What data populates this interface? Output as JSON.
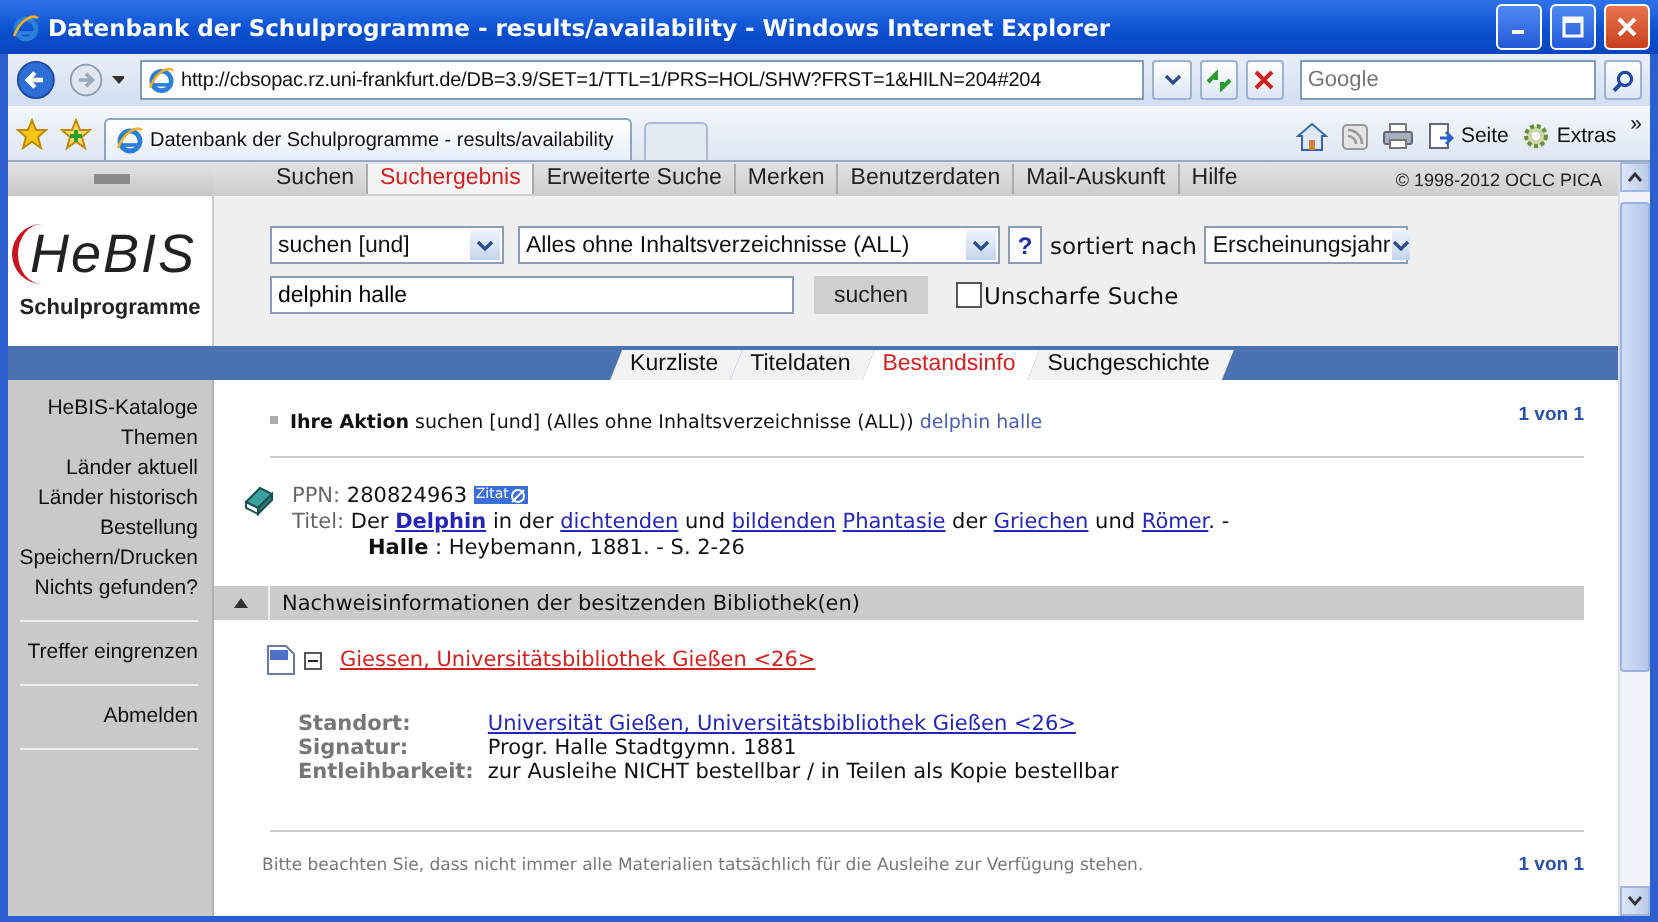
{
  "window": {
    "title": "Datenbank der Schulprogramme - results/availability - Windows Internet Explorer"
  },
  "browser": {
    "address": "http://cbsopac.rz.uni-frankfurt.de/DB=3.9/SET=1/TTL=1/PRS=HOL/SHW?FRST=1&HILN=204#204",
    "search_placeholder": "Google",
    "tab": "Datenbank der Schulprogramme - results/availability",
    "tools": [
      "Seite",
      "Extras"
    ],
    "overflow": "»"
  },
  "nav": {
    "items": [
      {
        "label": "Suchen",
        "selected": false
      },
      {
        "label": "Suchergebnis",
        "selected": true
      },
      {
        "label": "Erweiterte Suche",
        "selected": false
      },
      {
        "label": "Merken",
        "selected": false
      },
      {
        "label": "Benutzerdaten",
        "selected": false
      },
      {
        "label": "Mail-Auskunft",
        "selected": false
      },
      {
        "label": "Hilfe",
        "selected": false
      }
    ],
    "copyright": "© 1998-2012 OCLC PICA"
  },
  "logo": {
    "name": "HeBIS",
    "subtitle": "Schulprogramme"
  },
  "search": {
    "operator": "suchen [und]",
    "index": "Alles ohne Inhaltsverzeichnisse (ALL)",
    "help": "?",
    "sort_label": "sortiert nach",
    "sort": "Erscheinungsjahr",
    "query": "delphin halle",
    "button": "suchen",
    "fuzzy": {
      "label": "Unscharfe Suche",
      "checked": false
    }
  },
  "view_tabs": [
    {
      "label": "Kurzliste",
      "selected": false
    },
    {
      "label": "Titeldaten",
      "selected": false
    },
    {
      "label": "Bestandsinfo",
      "selected": true
    },
    {
      "label": "Suchgeschichte",
      "selected": false
    }
  ],
  "sidebar": {
    "groups": [
      [
        {
          "label": "HeBIS-Kataloge"
        },
        {
          "label": "Themen"
        },
        {
          "label": "Länder aktuell"
        },
        {
          "label": "Länder historisch"
        },
        {
          "label": "Bestellung"
        },
        {
          "label": "Speichern/Drucken"
        },
        {
          "label": "Nichts gefunden?"
        }
      ],
      [
        {
          "label": "Treffer eingrenzen"
        }
      ],
      [
        {
          "label": "Abmelden"
        }
      ]
    ]
  },
  "action": {
    "label": "Ihre Aktion",
    "text": "suchen [und] (Alles ohne Inhaltsverzeichnisse (ALL))",
    "query": "delphin halle",
    "pager": "1 von 1"
  },
  "record": {
    "ppn_label": "PPN:",
    "ppn": "280824963",
    "cite": "Zitat",
    "title_label": "Titel:",
    "title": [
      {
        "kind": "text",
        "text": "Der "
      },
      {
        "kind": "strong-link",
        "text": "Delphin"
      },
      {
        "kind": "text",
        "text": " in der "
      },
      {
        "kind": "link",
        "text": "dichtenden"
      },
      {
        "kind": "text",
        "text": " und "
      },
      {
        "kind": "link",
        "text": "bildenden"
      },
      {
        "kind": "link",
        "text": "Phantasie"
      },
      {
        "kind": "text",
        "text": " der "
      },
      {
        "kind": "link",
        "text": "Griechen"
      },
      {
        "kind": "text",
        "text": " und "
      },
      {
        "kind": "link",
        "text": "Römer"
      },
      {
        "kind": "text",
        "text": ". -"
      }
    ],
    "imprint": "**Halle** : Heybemann, 1881. - S. 2-26"
  },
  "holdings": {
    "heading": "Nachweisinformationen der besitzenden Bibliothek(en)",
    "expanded": true,
    "library": "Giessen, Universitätsbibliothek Gießen <26>",
    "fields": [
      {
        "label": "Standort:",
        "value": "Universität Gießen, Universitätsbibliothek Gießen <26>",
        "link": true
      },
      {
        "label": "Signatur:",
        "value": "Progr. Halle Stadtgymn. 1881",
        "link": false
      },
      {
        "label": "Entleihbarkeit:",
        "value": "zur Ausleihe NICHT bestellbar / in Teilen als Kopie bestellbar",
        "link": false
      }
    ]
  },
  "footer": {
    "note": "Bitte beachten Sie, dass nicht immer alle Materialien tatsächlich für die Ausleihe zur Verfügung stehen.",
    "pager": "1 von 1"
  }
}
